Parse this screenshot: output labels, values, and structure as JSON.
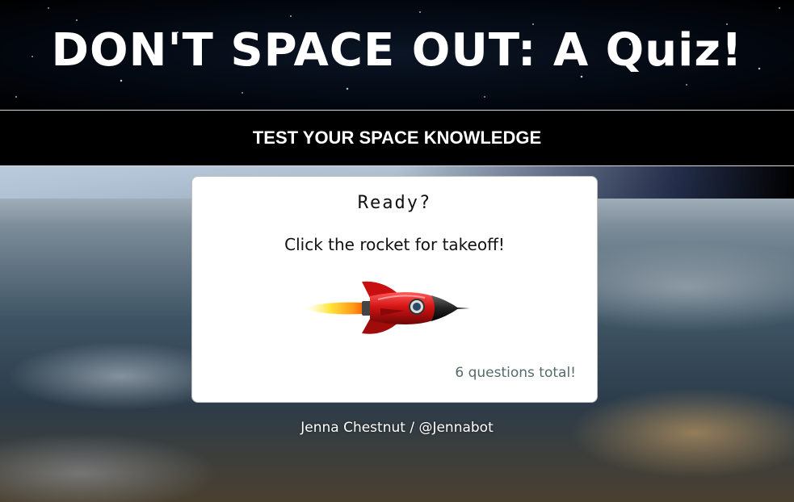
{
  "header": {
    "title": "DON'T SPACE OUT: A Quiz!",
    "subtitle": "TEST YOUR SPACE KNOWLEDGE"
  },
  "card": {
    "heading": "Ready?",
    "instructions": "Click the rocket for takeoff!",
    "rocket_icon": "rocket-icon",
    "question_count": "6 questions total!"
  },
  "footer": {
    "credit": "Jenna Chestnut / @Jennabot"
  },
  "colors": {
    "card_background": "#ffffff",
    "subheader_background": "#000000",
    "question_count_text": "#556b6b",
    "rocket_body": "#d01818"
  }
}
